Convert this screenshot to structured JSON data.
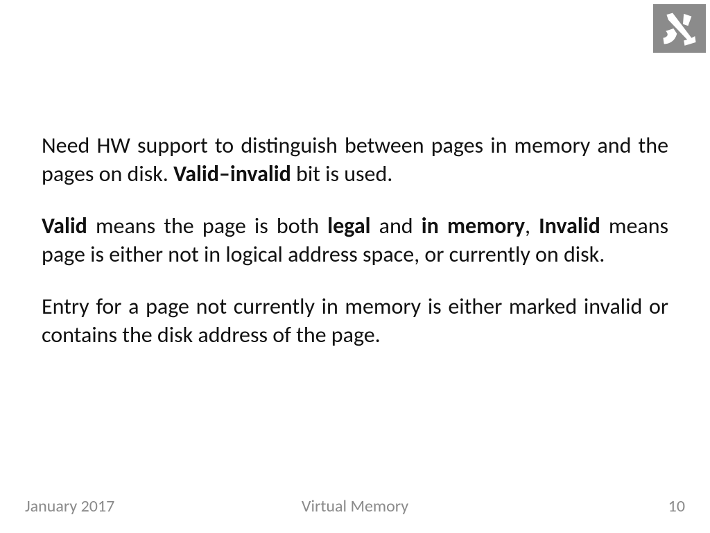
{
  "logo": {
    "name": "aleph-logo"
  },
  "paragraphs": {
    "p1_a": "Need HW support to distinguish between pages in memory and the pages on disk. ",
    "p1_b": "Valid–invalid",
    "p1_c": " bit is used.",
    "p2_a": "Valid",
    "p2_b": " means the page is both ",
    "p2_c": "legal",
    "p2_d": " and ",
    "p2_e": "in memory",
    "p2_f": ", ",
    "p2_g": "Invalid",
    "p2_h": " means page is either not in logical address space, or currently on disk.",
    "p3": "Entry for a page not currently in memory is either marked invalid or contains the disk address of the page."
  },
  "footer": {
    "date": "January 2017",
    "title": "Virtual Memory",
    "page": "10"
  }
}
